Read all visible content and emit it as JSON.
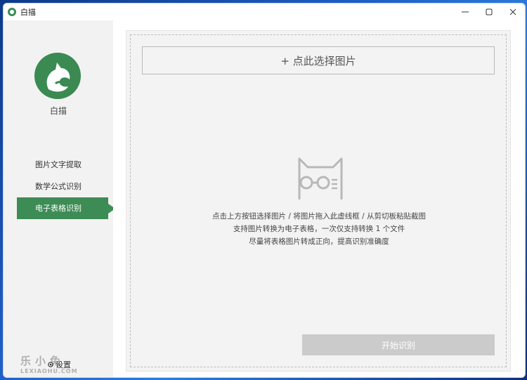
{
  "window": {
    "title": "白描",
    "controls": {
      "minimize": "—",
      "maximize": "☐",
      "close": "✕"
    }
  },
  "sidebar": {
    "logo_label": "白描",
    "items": [
      {
        "label": "图片文字提取",
        "active": false
      },
      {
        "label": "数学公式识别",
        "active": false
      },
      {
        "label": "电子表格识别",
        "active": true
      }
    ],
    "settings_icon": "gear-icon",
    "settings_label": "设置",
    "watermark": {
      "big": "乐小兔",
      "small": "LEXIAOHU.COM"
    }
  },
  "main": {
    "select_button": "+ 点此选择图片",
    "illustration_icon": "cat-with-glasses-icon",
    "hints": [
      "点击上方按钮选择图片 / 将图片拖入此虚线框 / 从剪切板粘贴截图",
      "支持图片转换为电子表格，一次仅支持转换 1 个文件",
      "尽量将表格图片转成正向，提高识别准确度"
    ],
    "start_button": "开始识别"
  },
  "colors": {
    "accent": "#3d8c55",
    "button_disabled": "#cbcbcb",
    "panel_bg": "#f3f3f3"
  }
}
